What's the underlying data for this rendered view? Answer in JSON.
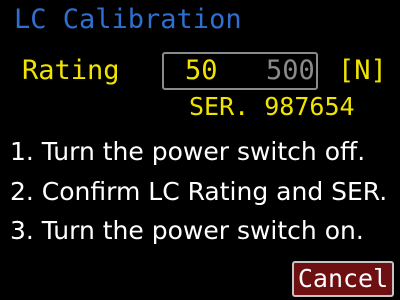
{
  "header": {
    "title": "LC Calibration"
  },
  "rating": {
    "label": "Rating",
    "selected_value": "50",
    "alternate_value": "500",
    "unit": "[N]"
  },
  "serial": {
    "text": "SER. 987654"
  },
  "instructions": [
    "1. Turn the power switch off.",
    "2. Confirm LC Rating and SER.",
    "3. Turn the power switch on."
  ],
  "actions": {
    "cancel_label": "Cancel"
  },
  "colors": {
    "background": "#000000",
    "title": "#2f6fd0",
    "value_text": "#f0e400",
    "inactive_text": "#8a8a8a",
    "body_text": "#ffffff",
    "cancel_fill": "#6e0f12"
  }
}
